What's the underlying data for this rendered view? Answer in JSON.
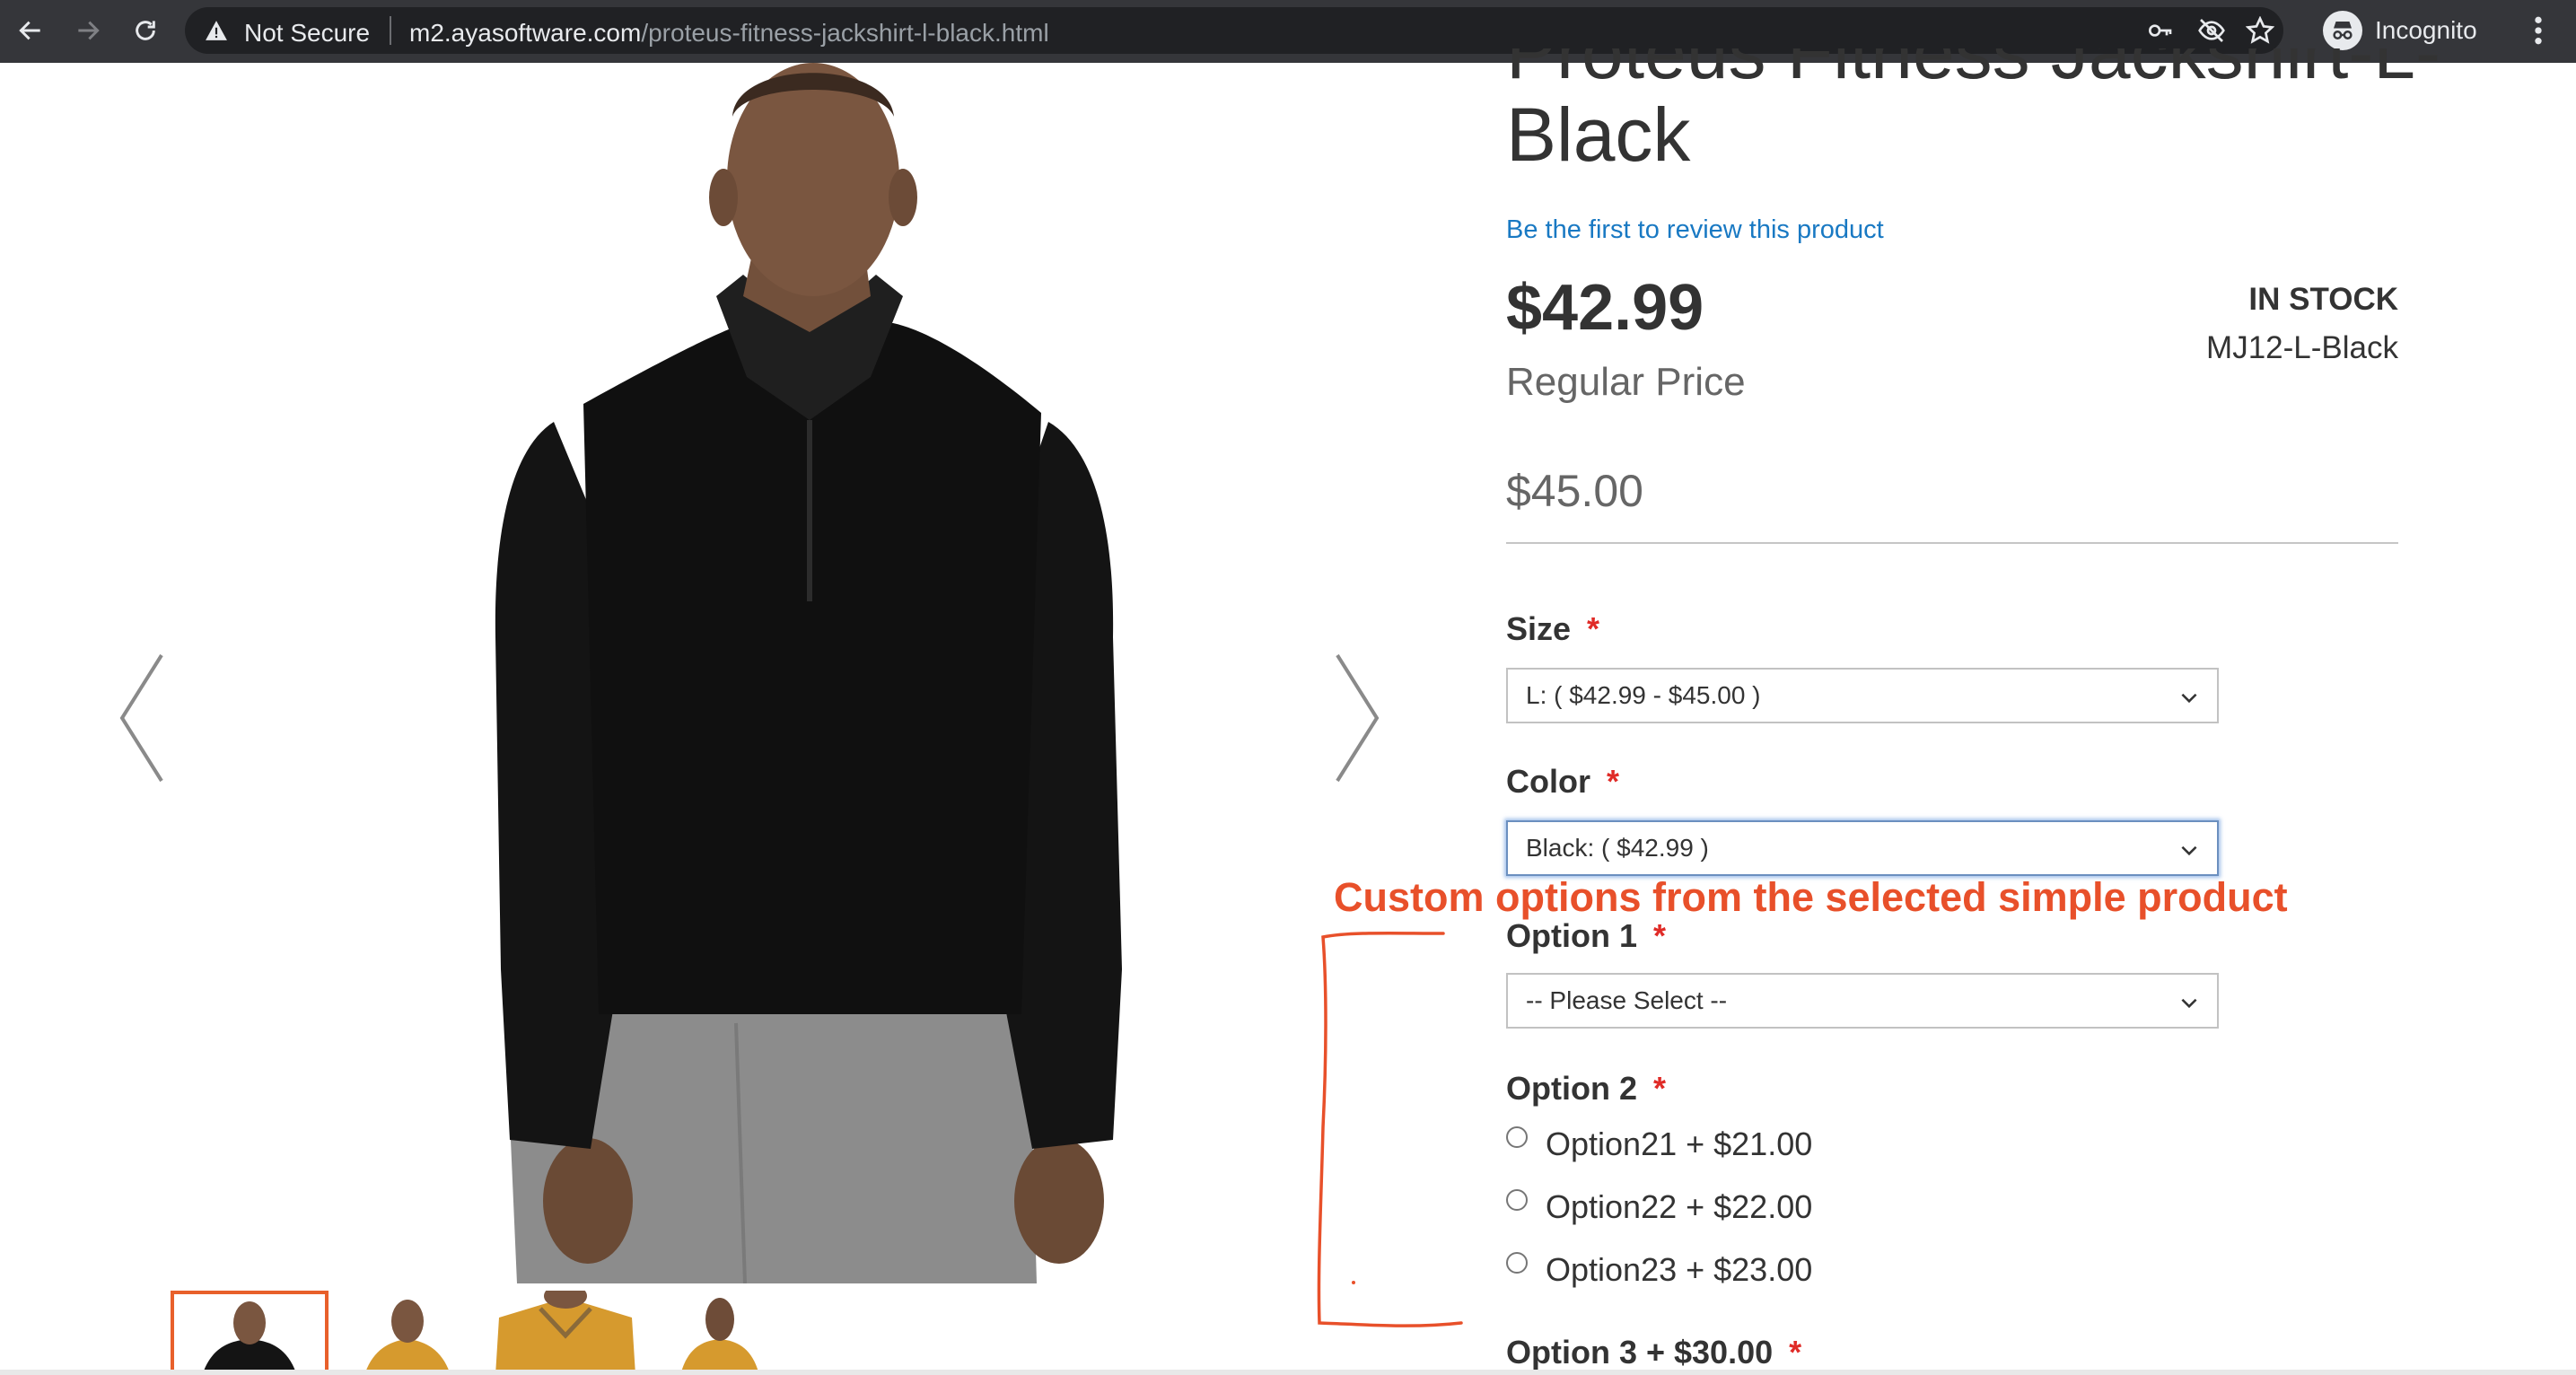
{
  "browser": {
    "security_label": "Not Secure",
    "url_host": "m2.ayasoftware.com",
    "url_path": "/proteus-fitness-jackshirt-l-black.html",
    "profile_label": "Incognito",
    "icons": [
      "back-icon",
      "forward-icon",
      "reload-icon",
      "warning-icon",
      "key-icon",
      "eye-off-icon",
      "star-icon",
      "incognito-icon",
      "menu-icon"
    ]
  },
  "product": {
    "title_line1": "Proteus Fitness Jackshirt-L-",
    "title_line2": "Black",
    "review_link": "Be the first to review this product",
    "final_price": "$42.99",
    "regular_price_label": "Regular Price",
    "regular_price": "$45.00",
    "stock_status": "IN STOCK",
    "sku": "MJ12-L-Black"
  },
  "options": {
    "size": {
      "label": "Size",
      "required": "*",
      "value": "L: ( $42.99 - $45.00 )"
    },
    "color": {
      "label": "Color",
      "required": "*",
      "value": "Black: ( $42.99 )"
    },
    "option1": {
      "label": "Option 1",
      "required": "*",
      "value": "-- Please Select --"
    },
    "option2": {
      "label": "Option 2",
      "required": "*",
      "choices": [
        "Option21 + $21.00",
        "Option22 + $22.00",
        "Option23 + $23.00"
      ]
    },
    "option3": {
      "label": "Option 3 + $30.00",
      "required": "*"
    }
  },
  "annotation": {
    "text": "Custom options from the selected simple product",
    "color": "#e8502a"
  },
  "colors": {
    "link": "#1979c3",
    "required": "#e02b27",
    "active_thumb_border": "#e8602b"
  }
}
